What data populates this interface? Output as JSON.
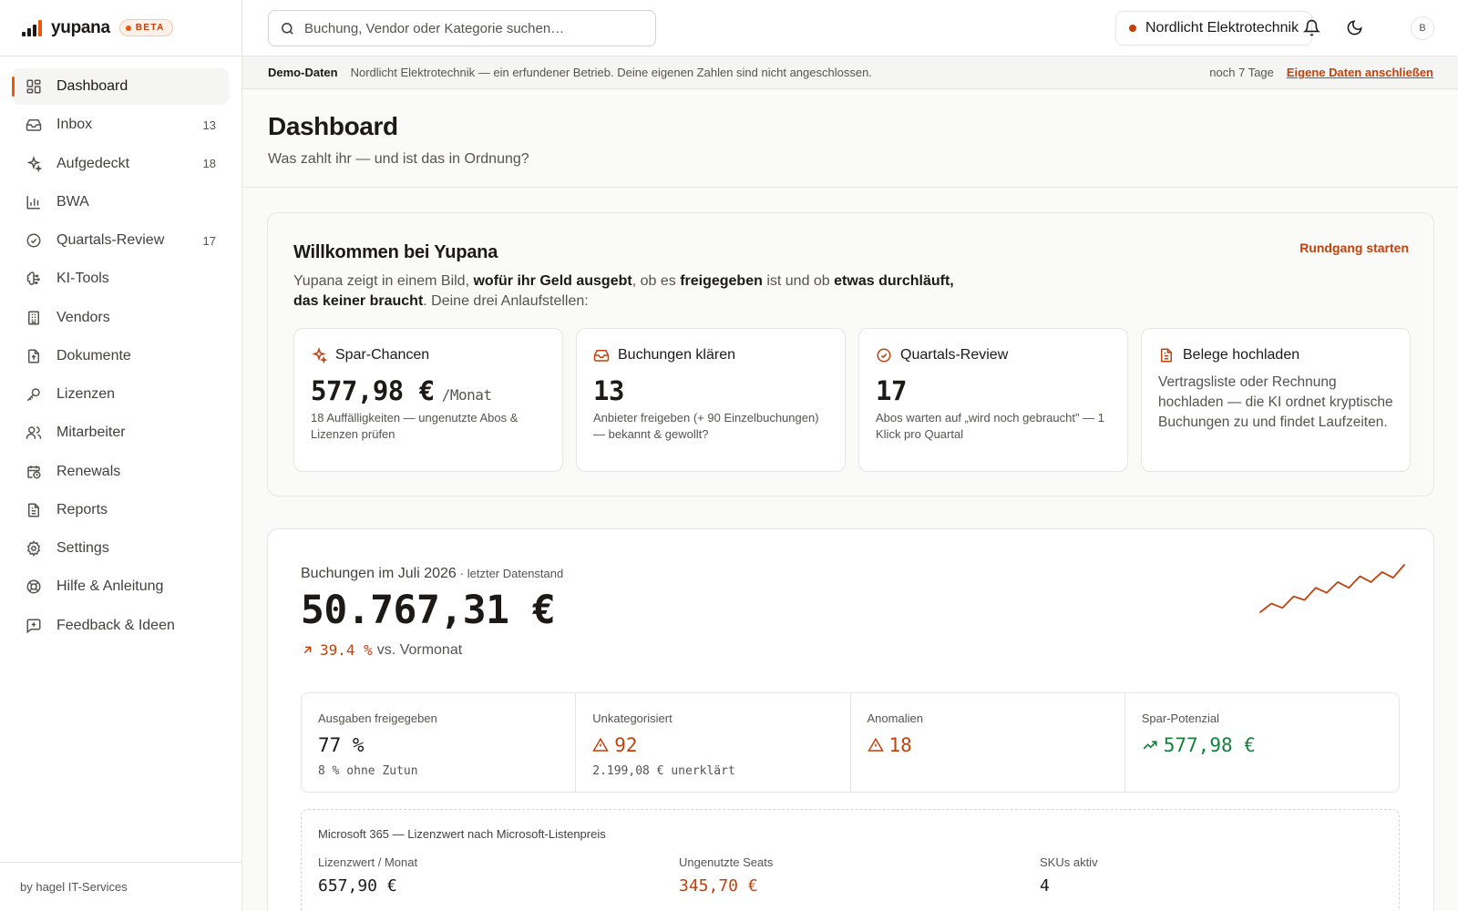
{
  "brand": {
    "name": "yupana",
    "badge": "BETA"
  },
  "sidebar": {
    "items": [
      {
        "label": "Dashboard",
        "count": ""
      },
      {
        "label": "Inbox",
        "count": "13"
      },
      {
        "label": "Aufgedeckt",
        "count": "18"
      },
      {
        "label": "BWA",
        "count": ""
      },
      {
        "label": "Quartals-Review",
        "count": "17"
      },
      {
        "label": "KI-Tools",
        "count": ""
      },
      {
        "label": "Vendors",
        "count": ""
      },
      {
        "label": "Dokumente",
        "count": ""
      },
      {
        "label": "Lizenzen",
        "count": ""
      },
      {
        "label": "Mitarbeiter",
        "count": ""
      },
      {
        "label": "Renewals",
        "count": ""
      },
      {
        "label": "Reports",
        "count": ""
      },
      {
        "label": "Settings",
        "count": ""
      },
      {
        "label": "Hilfe & Anleitung",
        "count": ""
      },
      {
        "label": "Feedback & Ideen",
        "count": ""
      }
    ],
    "footer": "by hagel IT-Services"
  },
  "topbar": {
    "search_placeholder": "Buchung, Vendor oder Kategorie suchen…",
    "org_name": "Nordlicht Elektrotechnik",
    "avatar_initial": "B"
  },
  "demo_banner": {
    "tag": "Demo-Daten",
    "message": "Nordlicht Elektrotechnik — ein erfundener Betrieb. Deine eigenen Zahlen sind nicht angeschlossen.",
    "days_left": "noch 7 Tage",
    "link": "Eigene Daten anschließen"
  },
  "page": {
    "title": "Dashboard",
    "subtitle": "Was zahlt ihr — und ist das in Ordnung?"
  },
  "welcome": {
    "title": "Willkommen bei Yupana",
    "tour_link": "Rundgang starten",
    "intro": {
      "p1": "Yupana zeigt in einem Bild, ",
      "b1": "wofür ihr Geld ausgebt",
      "p2": ", ob es ",
      "b2": "freigegeben",
      "p3": " ist und ob ",
      "b3": "etwas durchläuft, das keiner braucht",
      "p4": ". Deine drei Anlaufstellen:"
    },
    "tiles": [
      {
        "title": "Spar-Chancen",
        "value": "577,98 €",
        "unit": "/Monat",
        "desc": "18 Auffälligkeiten — ungenutzte Abos & Lizenzen prüfen"
      },
      {
        "title": "Buchungen klären",
        "value": "13",
        "desc": "Anbieter freigeben (+ 90 Einzelbuchungen) — bekannt & gewollt?"
      },
      {
        "title": "Quartals-Review",
        "value": "17",
        "desc": "Abos warten auf „wird noch gebraucht\" — 1 Klick pro Quartal"
      },
      {
        "title": "Belege hochladen",
        "desc": "Vertragsliste oder Rechnung hochladen — die KI ordnet kryptische Buchungen zu und findet Laufzeiten."
      }
    ]
  },
  "bookings": {
    "label": "Buchungen im Juli 2026",
    "meta": "· letzter Datenstand",
    "total": "50.767,31 €",
    "trend_pct": "39.4 %",
    "trend_text": "vs. Vormonat",
    "sparkline": [
      2,
      14,
      8,
      24,
      19,
      36,
      29,
      44,
      36,
      52,
      44,
      58,
      50,
      68
    ],
    "kpis": [
      {
        "label": "Ausgaben freigegeben",
        "value": "77 %",
        "sub": "8 % ohne Zutun"
      },
      {
        "label": "Unkategorisiert",
        "value": "92",
        "sub": "2.199,08 € unerklärt"
      },
      {
        "label": "Anomalien",
        "value": "18",
        "sub": ""
      },
      {
        "label": "Spar-Potenzial",
        "value": "577,98 €",
        "sub": ""
      }
    ],
    "microsoft": {
      "title": "Microsoft 365 — Lizenzwert nach Microsoft-Listenpreis",
      "cols": [
        {
          "label": "Lizenzwert / Monat",
          "value": "657,90 €"
        },
        {
          "label": "Ungenutzte Seats",
          "value": "345,70 €"
        },
        {
          "label": "SKUs aktiv",
          "value": "4"
        }
      ]
    }
  },
  "colors": {
    "accent": "#c2410c",
    "positive": "#15803d",
    "text": "#1c1917",
    "muted": "#57534e"
  }
}
